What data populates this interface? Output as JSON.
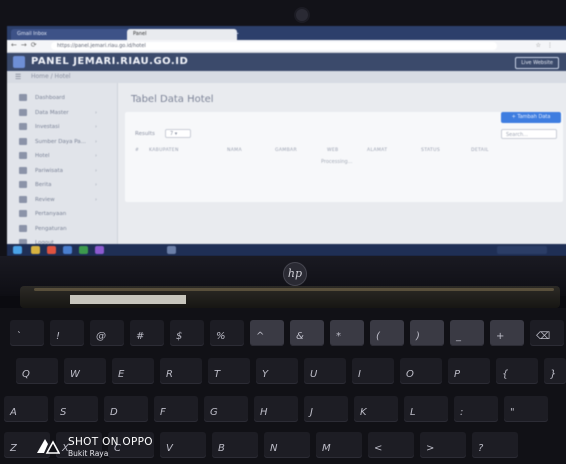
{
  "browser": {
    "tabs": [
      {
        "label": "Gmail Inbox"
      },
      {
        "label": "Panel",
        "active": true
      }
    ],
    "url": "https://panel.jemari.riau.go.id/hotel"
  },
  "app": {
    "title": "PANEL JEMARI.RIAU.GO.ID",
    "live_button": "Live Website",
    "breadcrumb": "Home / Hotel"
  },
  "sidebar": {
    "items": [
      {
        "label": "Dashboard",
        "caret": ""
      },
      {
        "label": "Data Master",
        "caret": "›"
      },
      {
        "label": "Investasi",
        "caret": "›"
      },
      {
        "label": "Sumber Daya Pa...",
        "caret": "›"
      },
      {
        "label": "Hotel",
        "caret": "›"
      },
      {
        "label": "Pariwisata",
        "caret": "›"
      },
      {
        "label": "Berita",
        "caret": "›"
      },
      {
        "label": "Review",
        "caret": "›"
      },
      {
        "label": "Pertanyaan",
        "caret": ""
      },
      {
        "label": "Pengaturan",
        "caret": ""
      },
      {
        "label": "Logout",
        "caret": ""
      }
    ]
  },
  "main": {
    "page_title": "Tabel Data Hotel",
    "add_button": "+ Tambah Data",
    "results_label": "Results",
    "page_length": "7",
    "search_placeholder": "Search...",
    "columns": [
      "#",
      "KABUPATEN",
      "NAMA",
      "GAMBAR",
      "WEB",
      "ALAMAT",
      "STATUS",
      "DETAIL"
    ],
    "processing": "Processing..."
  },
  "laptop": {
    "brand": "hp"
  },
  "keyboard": {
    "rows": [
      [
        "`",
        "!",
        "@",
        "#",
        "$",
        "%",
        "^",
        "&",
        "*",
        "(",
        ")",
        "_",
        "+",
        "⌫"
      ],
      [
        "Q",
        "W",
        "E",
        "R",
        "T",
        "Y",
        "U",
        "I",
        "O",
        "P",
        "{",
        "}"
      ],
      [
        "A",
        "S",
        "D",
        "F",
        "G",
        "H",
        "J",
        "K",
        "L",
        ":",
        "\""
      ],
      [
        "Z",
        "X",
        "C",
        "V",
        "B",
        "N",
        "M",
        "<",
        ">",
        "?"
      ]
    ]
  },
  "watermark": {
    "title": "SHOT ON OPPO",
    "location": "Bukit Raya"
  }
}
